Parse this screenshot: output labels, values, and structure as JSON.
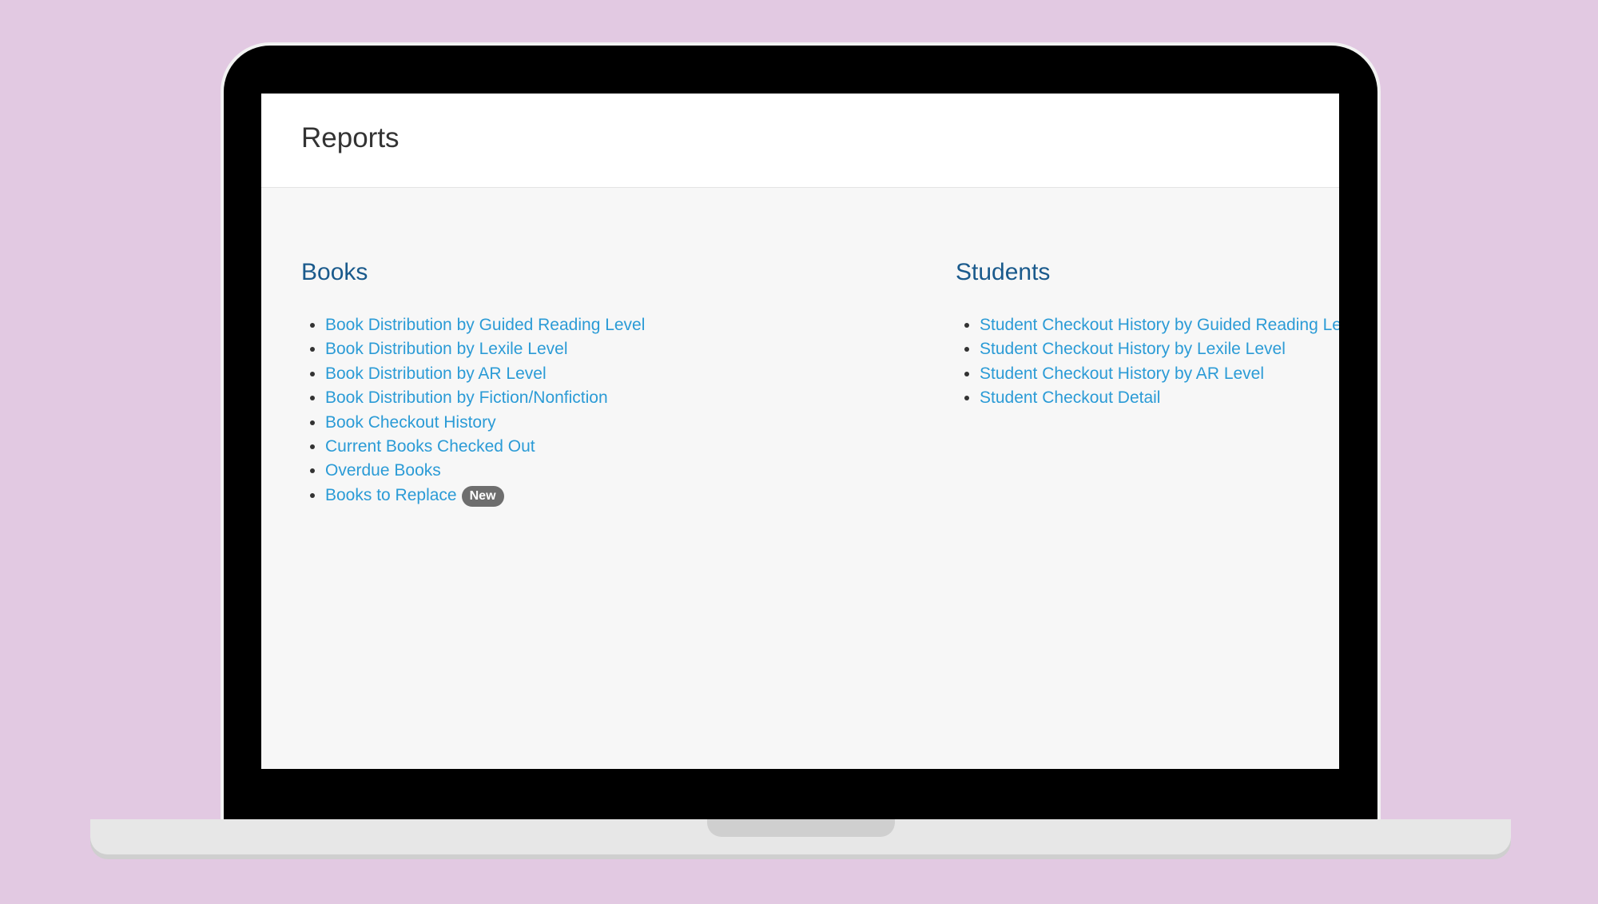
{
  "page": {
    "title": "Reports"
  },
  "books": {
    "heading": "Books",
    "items": [
      {
        "label": "Book Distribution by Guided Reading Level"
      },
      {
        "label": "Book Distribution by Lexile Level"
      },
      {
        "label": "Book Distribution by AR Level"
      },
      {
        "label": "Book Distribution by Fiction/Nonfiction"
      },
      {
        "label": "Book Checkout History"
      },
      {
        "label": "Current Books Checked Out"
      },
      {
        "label": "Overdue Books"
      },
      {
        "label": "Books to Replace",
        "badge": "New"
      }
    ]
  },
  "students": {
    "heading": "Students",
    "items": [
      {
        "label": "Student Checkout History by Guided Reading Le"
      },
      {
        "label": "Student Checkout History by Lexile Level"
      },
      {
        "label": "Student Checkout History by AR Level"
      },
      {
        "label": "Student Checkout Detail"
      }
    ]
  },
  "colors": {
    "background": "#e2c9e2",
    "link": "#2b9bd6",
    "heading": "#1a5a8c",
    "badge": "#6e6e6e"
  }
}
